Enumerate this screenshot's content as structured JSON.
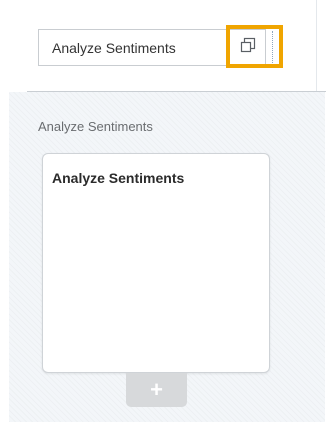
{
  "header": {
    "field_value": "Analyze Sentiments",
    "copy_button_icon": "copy-icon",
    "highlight_color": "#f0a500"
  },
  "section": {
    "label": "Analyze Sentiments"
  },
  "card": {
    "title": "Analyze Sentiments"
  },
  "add_button": {
    "label": "+",
    "icon": "plus-icon"
  }
}
